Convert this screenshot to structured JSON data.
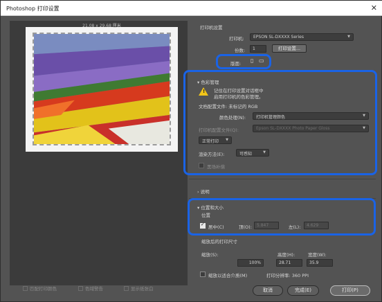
{
  "window": {
    "title": "Photoshop 打印设置",
    "close_icon": "close-icon"
  },
  "preview": {
    "page_size_label": "21.08 x 29.68 厘米"
  },
  "printer_setup": {
    "section_title": "打印机设置",
    "printer_label": "打印机:",
    "printer_value": "EPSON SL-DXXXX Series",
    "copies_label": "份数:",
    "copies_value": "1",
    "print_settings_button": "打印设置...",
    "layout_label": "版面:",
    "layout_icons": [
      "portrait-icon",
      "landscape-icon"
    ]
  },
  "color_management": {
    "section_title": "色彩管理",
    "warning_icon": "warning-icon",
    "warning_text_line1": "记住在打印设置对话框中",
    "warning_text_line2": "启用打印机的色彩管理。",
    "document_profile": "文档配置文件: 未标记的 RGB",
    "color_handling_label": "颜色处理(N):",
    "color_handling_value": "打印机管理颜色",
    "printer_profile_label": "打印机配置文件(Q):",
    "printer_profile_value": "Epson SL-DXXXX Photo Paper Gloss",
    "normal_printing_value": "正常打印",
    "rendering_intent_label": "渲染方法(E):",
    "rendering_intent_value": "可感知",
    "black_point_label": "黑场补偿"
  },
  "description": {
    "section_title": "说明"
  },
  "position_size": {
    "section_title": "位置和大小",
    "position_label": "位置",
    "center_label": "居中(C)",
    "center_checked": true,
    "top_label": "顶(O):",
    "top_value": "5.847",
    "left_label": "左(L):",
    "left_value": "4.629",
    "scaled_print_size_label": "缩放后的打印尺寸",
    "scale_label": "缩放(S):",
    "scale_value": "100%",
    "height_label": "高度(H):",
    "height_value": "28.71",
    "width_label": "宽度(W):",
    "width_value": "35.9",
    "scale_to_fit_label": "缩放以适合介质(M)",
    "print_resolution": "打印分辨率: 360 PPI"
  },
  "bottom_options": {
    "match_colors": "匹配打印颜色",
    "gamut_warning": "色域警告",
    "show_paper_white": "显示纸张白"
  },
  "footer": {
    "cancel_label": "取消",
    "done_label": "完成(E)",
    "print_label": "打印(P)"
  }
}
